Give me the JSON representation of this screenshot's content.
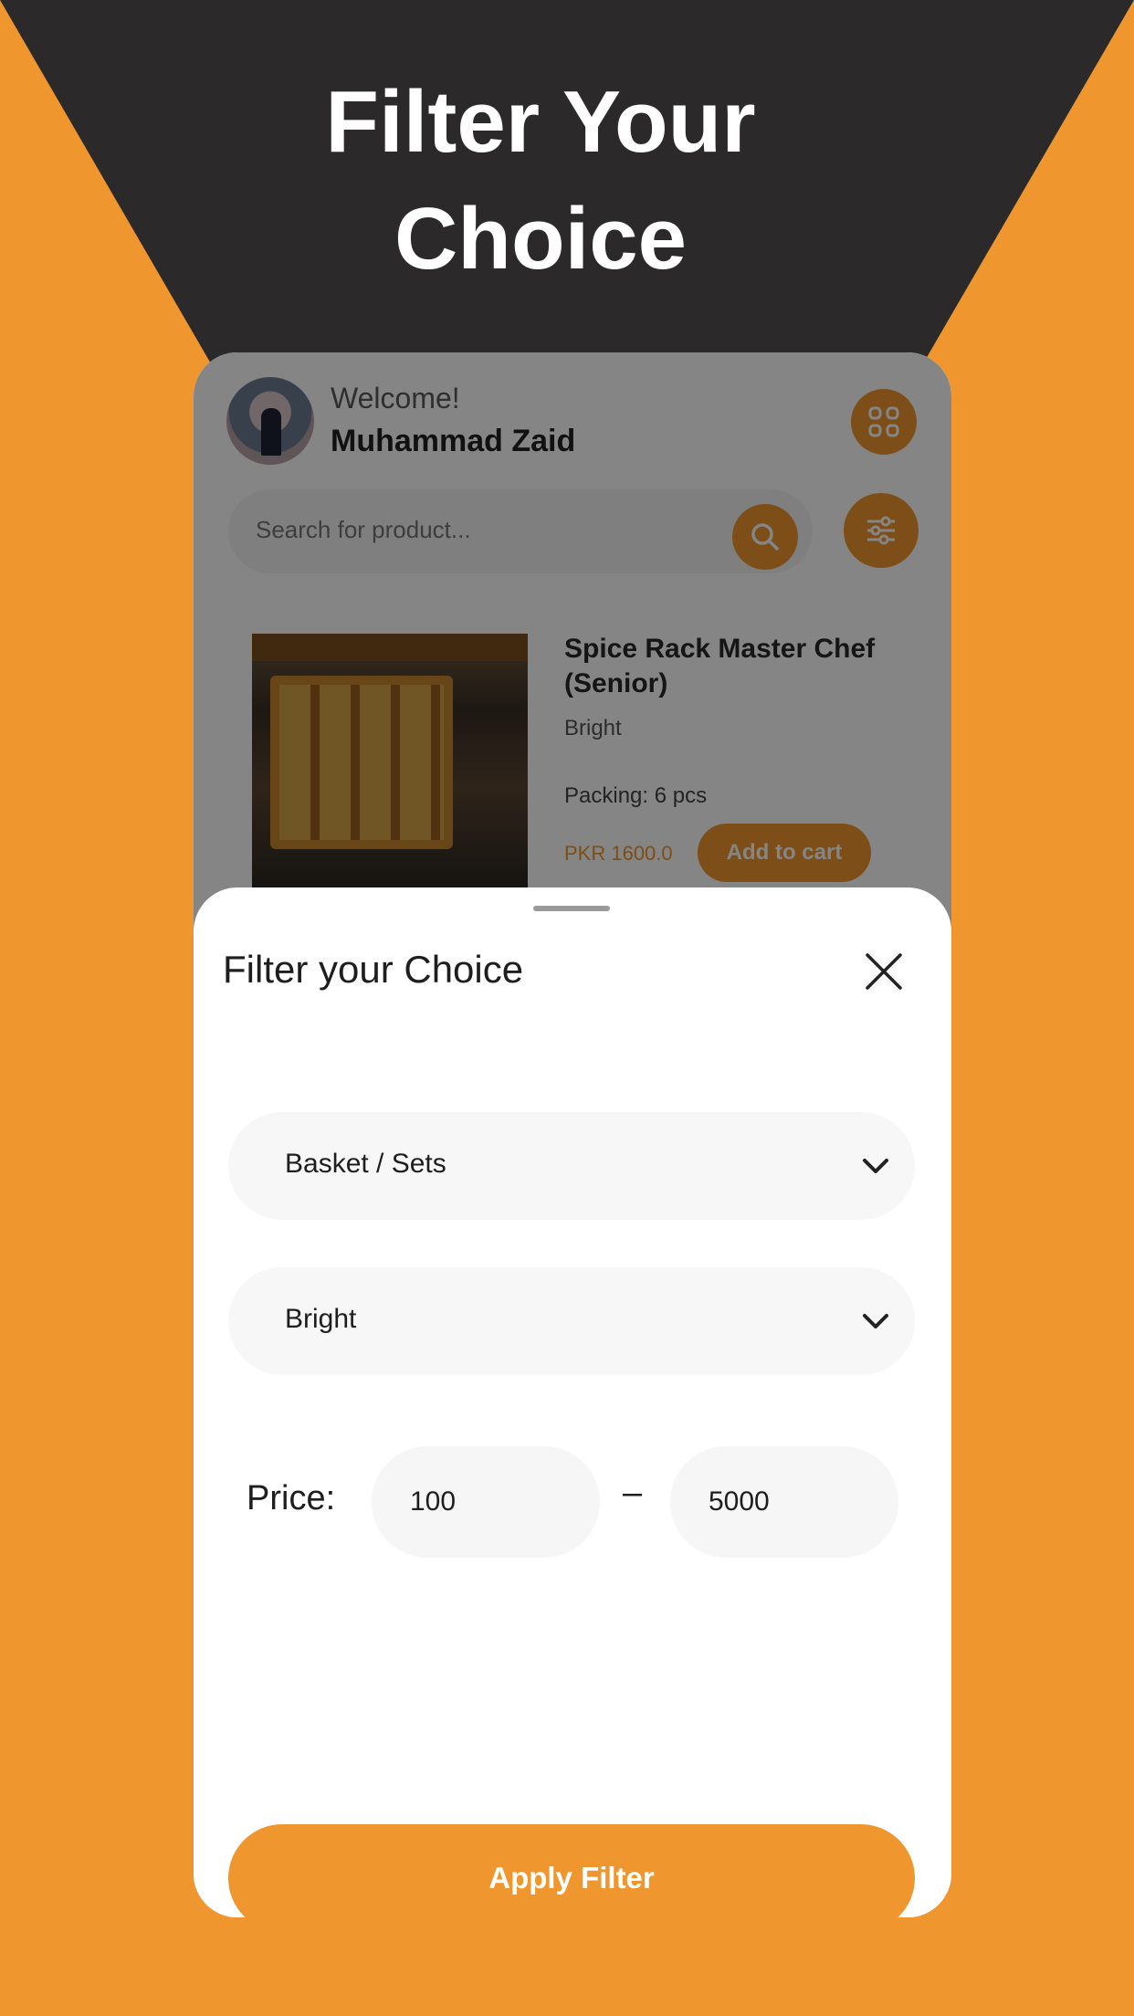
{
  "promo": {
    "headline_line1": "Filter Your",
    "headline_line2": "Choice"
  },
  "header": {
    "greeting": "Welcome!",
    "user_name": "Muhammad Zaid"
  },
  "search": {
    "placeholder": "Search for product..."
  },
  "product": {
    "title": "Spice Rack Master Chef (Senior)",
    "brand": "Bright",
    "packing": "Packing: 6 pcs",
    "price": "PKR 1600.0",
    "add_to_cart_label": "Add to cart"
  },
  "filter_sheet": {
    "title": "Filter your Choice",
    "category_value": "Basket / Sets",
    "brand_value": "Bright",
    "price_label": "Price:",
    "price_min": "100",
    "price_separator": "–",
    "price_max": "5000",
    "apply_label": "Apply Filter"
  },
  "colors": {
    "accent": "#F0962F",
    "dark": "#2B292A",
    "sheet_bg": "#FFFFFF",
    "field_bg": "#F7F7F7"
  }
}
